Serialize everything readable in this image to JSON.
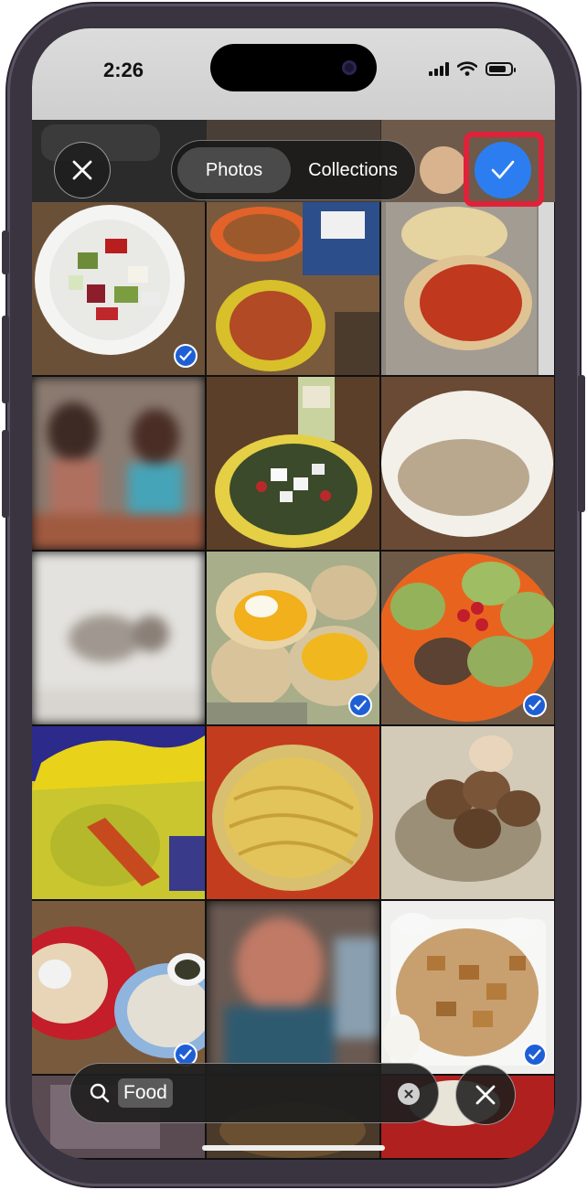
{
  "status_bar": {
    "time": "2:26"
  },
  "top_bar": {
    "close_icon": "close-icon",
    "tabs": [
      {
        "label": "Photos",
        "active": true
      },
      {
        "label": "Collections",
        "active": false
      }
    ],
    "confirm_icon": "checkmark-icon"
  },
  "grid": {
    "items": [
      {
        "name": "greek-salad-bowl",
        "selected": true
      },
      {
        "name": "pizzas-on-plates",
        "selected": false
      },
      {
        "name": "pizza-dough-on-tray",
        "selected": false
      },
      {
        "name": "kids-blurred",
        "selected": false
      },
      {
        "name": "salad-with-feta",
        "selected": false
      },
      {
        "name": "dough-in-bowl",
        "selected": false
      },
      {
        "name": "blurred-photo",
        "selected": false
      },
      {
        "name": "poached-eggs-toast",
        "selected": true
      },
      {
        "name": "avocado-toast-plate",
        "selected": true
      },
      {
        "name": "takis-bag",
        "selected": false
      },
      {
        "name": "noodles-bowl",
        "selected": false
      },
      {
        "name": "brown-eggs-basket",
        "selected": false
      },
      {
        "name": "dinner-plates",
        "selected": true
      },
      {
        "name": "blurred-person",
        "selected": false
      },
      {
        "name": "fried-chicken-box",
        "selected": true
      }
    ]
  },
  "search": {
    "token": "Food",
    "search_icon": "search-icon",
    "clear_icon": "clear-icon"
  },
  "colors": {
    "accent": "#2c7ef0",
    "highlight": "#e0213a",
    "check": "#1f5fd6"
  }
}
